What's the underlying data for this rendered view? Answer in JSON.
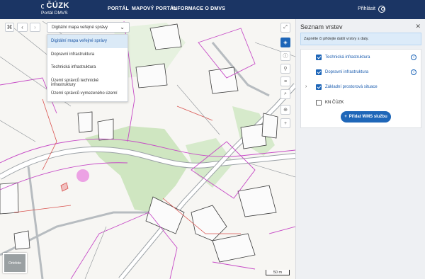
{
  "header": {
    "logo_main": "ČÚZK",
    "logo_sub": "Portál DMVS",
    "nav": [
      "PORTÁL",
      "MAPOVÝ PORTÁL",
      "INFORMACE O DMVS"
    ],
    "login": "Přihlásit"
  },
  "map_toolbar": {
    "selected_map": "Digitální mapa veřejné správy",
    "dropdown_options": [
      "Digitální mapa veřejné správy",
      "Dopravní infrastruktura",
      "Technická infrastruktura",
      "Území správců technické infrastruktury",
      "Území správců vymezeného území"
    ],
    "selected_index": 0
  },
  "minimap_label": "Ortofoto",
  "scale_label": "50 m",
  "panel": {
    "title": "Seznam vrstev",
    "info": "Zapněte či přidejte další vrstvy s daty.",
    "layers": [
      {
        "label": "Technická infrastruktura",
        "checked": true,
        "info": true,
        "expandable": false
      },
      {
        "label": "Dopravní infrastruktura",
        "checked": true,
        "info": true,
        "expandable": false
      },
      {
        "label": "Základní prostorová situace",
        "checked": true,
        "info": false,
        "expandable": true
      },
      {
        "label": "KN ČÚZK",
        "checked": false,
        "info": false,
        "expandable": false
      }
    ],
    "add_button": "Přidat WMS službu"
  },
  "colors": {
    "header_bg": "#1b3564",
    "accent": "#1e66b8",
    "map_green": "#cfe6c1",
    "map_pink": "#c64ac6",
    "map_red": "#d9534f"
  }
}
